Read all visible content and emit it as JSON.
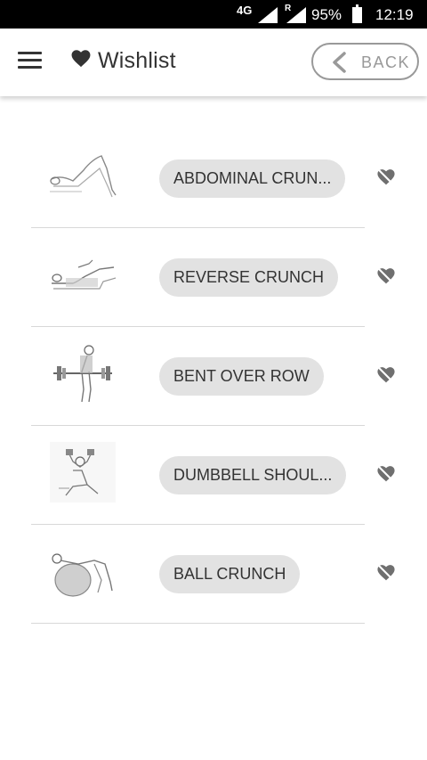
{
  "status_bar": {
    "network": "4G",
    "roaming": "R",
    "battery": "95%",
    "time": "12:19"
  },
  "app_bar": {
    "title": "Wishlist",
    "back_label": "BACK"
  },
  "items": [
    {
      "label": "ABDOMINAL CRUN..."
    },
    {
      "label": "REVERSE CRUNCH"
    },
    {
      "label": "BENT OVER ROW"
    },
    {
      "label": "DUMBBELL SHOUL..."
    },
    {
      "label": "BALL CRUNCH"
    }
  ],
  "icons": {
    "menu": "menu-icon",
    "title": "heart-icon",
    "back": "chevron-left-icon",
    "remove": "heart-broken-icon"
  }
}
